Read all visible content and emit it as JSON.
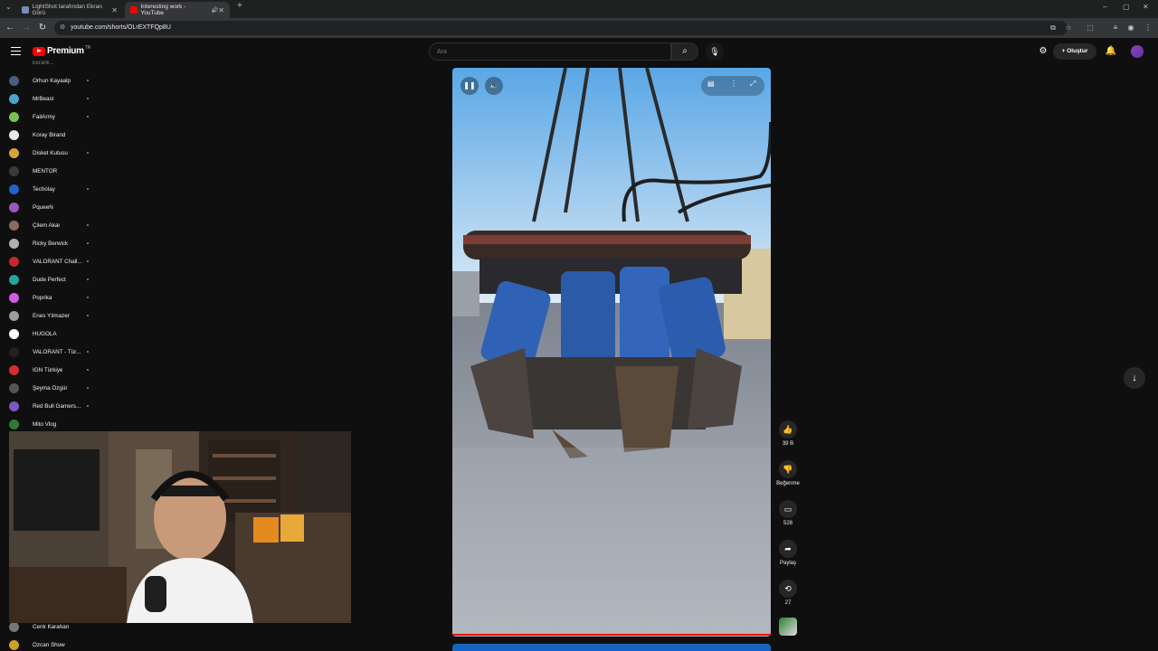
{
  "browser": {
    "tabs": [
      {
        "title": "LightShot tarafından Ekran Görü",
        "active": false
      },
      {
        "title": "Interesting work - YouTube",
        "active": true
      }
    ],
    "new_tab": "+",
    "url": "youtube.com/shorts/OLrEXTFQp8U",
    "window_controls": [
      "–",
      "▢",
      "✕"
    ]
  },
  "header": {
    "logo_text": "Premium",
    "logo_region": "TR",
    "search_placeholder": "Ara",
    "create_label": "Oluştur"
  },
  "sidebar": {
    "partial_top": "Ekranlı...",
    "subscriptions": [
      {
        "name": "Orhun Kayaalp",
        "color": "#4a5d7e",
        "new": true
      },
      {
        "name": "MrBeast",
        "color": "#4fa3d1",
        "new": true
      },
      {
        "name": "FailArmy",
        "color": "#7cbf4e",
        "new": true
      },
      {
        "name": "Koray Birand",
        "color": "#e8e8e8",
        "new": false
      },
      {
        "name": "Disket Kutusu",
        "color": "#d8a43a",
        "new": true
      },
      {
        "name": "MENTOR",
        "color": "#3a3a3a",
        "new": false
      },
      {
        "name": "Techolay",
        "color": "#1e63c9",
        "new": true
      },
      {
        "name": "PqueeN",
        "color": "#9b59b6",
        "new": false
      },
      {
        "name": "Çilem Akar",
        "color": "#8a6b5c",
        "new": true
      },
      {
        "name": "Ricky Berwick",
        "color": "#b0b0b0",
        "new": true
      },
      {
        "name": "VALORANT Chall...",
        "color": "#c62828",
        "new": true
      },
      {
        "name": "Dude Perfect",
        "color": "#26a69a",
        "new": true
      },
      {
        "name": "Poprika",
        "color": "#d05ce3",
        "new": true
      },
      {
        "name": "Enes Yılmazer",
        "color": "#9e9e9e",
        "new": true
      },
      {
        "name": "HUGOLA",
        "color": "#ffffff",
        "new": false
      },
      {
        "name": "VALORANT - Tür...",
        "color": "#222222",
        "new": true
      },
      {
        "name": "IGN Türkiye",
        "color": "#d32f2f",
        "new": true
      },
      {
        "name": "Şeyma Özgür",
        "color": "#555555",
        "new": true
      },
      {
        "name": "Red Bull Gamers...",
        "color": "#7e57c2",
        "new": true
      },
      {
        "name": "Mito Vlog",
        "color": "#2e7d32",
        "new": false
      }
    ],
    "bottom": [
      {
        "name": "Cenk Karahan",
        "color": "#777777"
      },
      {
        "name": "Özcan Show",
        "color": "#c9a227"
      }
    ]
  },
  "actions": {
    "like_count": "39 B",
    "dislike_label": "Beğenme",
    "comment_count": "528",
    "share_label": "Paylaş",
    "remix_count": "27"
  },
  "video": {
    "progress": 1.0
  },
  "colors": {
    "accent": "#ff0000",
    "background": "#0f0f0f",
    "new_dot": "#3ea6ff"
  }
}
